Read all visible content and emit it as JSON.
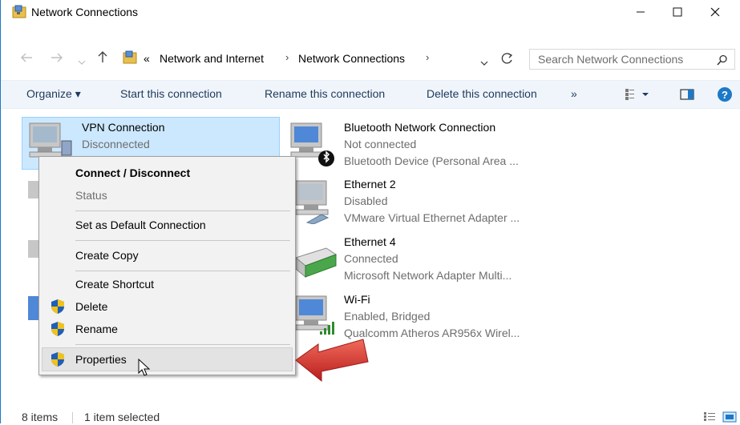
{
  "window": {
    "title": "Network Connections"
  },
  "breadcrumb": {
    "overflow": "«",
    "items": [
      "Network and Internet",
      "Network Connections"
    ],
    "sep": "›"
  },
  "search": {
    "placeholder": "Search Network Connections"
  },
  "toolbar": {
    "organize": "Organize ▾",
    "start": "Start this connection",
    "rename": "Rename this connection",
    "delete": "Delete this connection",
    "more": "»"
  },
  "connections": [
    {
      "name": "VPN Connection",
      "status": "Disconnected",
      "device": ""
    },
    {
      "name": "Bluetooth Network Connection",
      "status": "Not connected",
      "device": "Bluetooth Device (Personal Area ..."
    },
    {
      "name": "Ethernet 2",
      "status": "Disabled",
      "device": "VMware Virtual Ethernet Adapter ..."
    },
    {
      "name": "Ethernet 4",
      "status": "Connected",
      "device": "Microsoft Network Adapter Multi..."
    },
    {
      "name": "Wi-Fi",
      "status": "Enabled, Bridged",
      "device": "Qualcomm Atheros AR956x Wirel..."
    }
  ],
  "context_menu": {
    "connect": "Connect / Disconnect",
    "status": "Status",
    "set_default": "Set as Default Connection",
    "create_copy": "Create Copy",
    "create_shortcut": "Create Shortcut",
    "delete": "Delete",
    "rename": "Rename",
    "properties": "Properties"
  },
  "statusbar": {
    "count": "8 items",
    "selected": "1 item selected"
  },
  "colors": {
    "accent": "#1c79c7",
    "selection": "#cce8ff",
    "arrow": "#d9302c"
  }
}
